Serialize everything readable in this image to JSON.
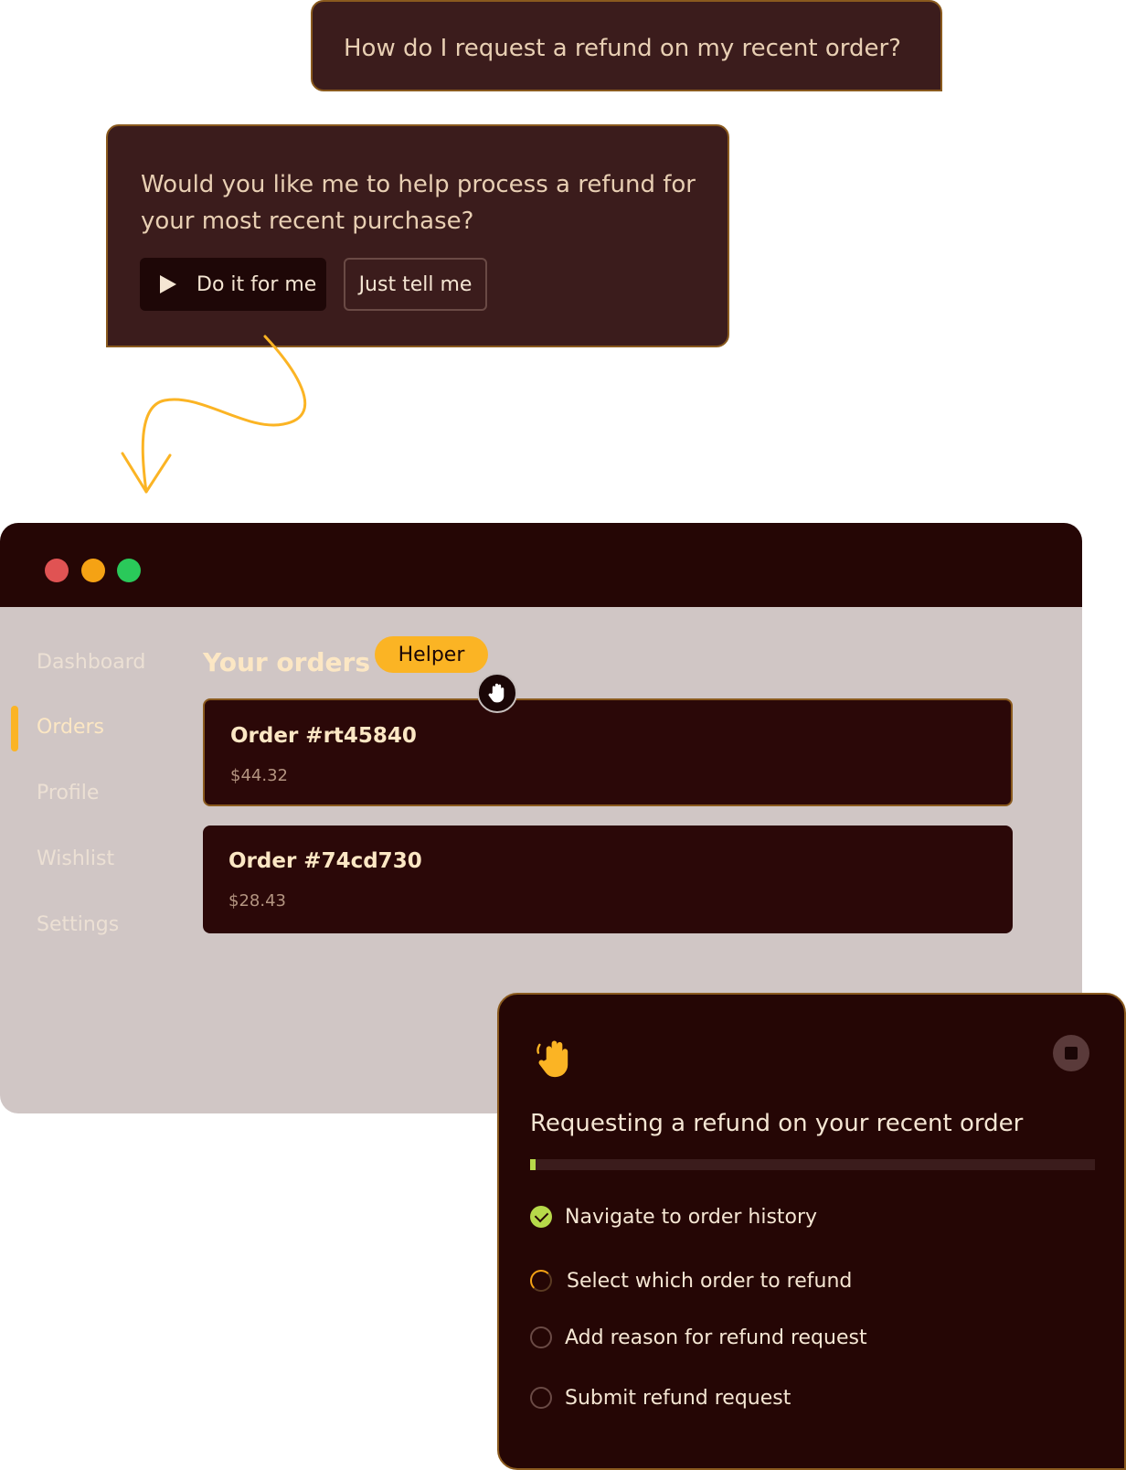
{
  "chat": {
    "user_message": "How do I request a refund on my recent order?",
    "assistant_message": "Would you like me to help process a refund for your most recent purchase?",
    "do_it_label": "Do it for me",
    "just_tell_label": "Just tell me"
  },
  "window": {
    "traffic_lights": [
      "close",
      "minimize",
      "zoom"
    ],
    "colors": {
      "red": "#e05353",
      "yellow": "#f5a214",
      "green": "#2ac95a"
    }
  },
  "sidebar": {
    "items": [
      {
        "label": "Dashboard",
        "active": false
      },
      {
        "label": "Orders",
        "active": true
      },
      {
        "label": "Profile",
        "active": false
      },
      {
        "label": "Wishlist",
        "active": false
      },
      {
        "label": "Settings",
        "active": false
      }
    ]
  },
  "main": {
    "title": "Your orders",
    "helper_label": "Helper",
    "orders": [
      {
        "name": "Order #rt45840",
        "price": "$44.32"
      },
      {
        "name": "Order #74cd730",
        "price": "$28.43"
      }
    ]
  },
  "helper_panel": {
    "title": "Requesting a refund on your recent order",
    "progress_fraction": 0.01,
    "steps": [
      {
        "label": "Navigate to order history",
        "status": "done"
      },
      {
        "label": "Select which order to refund",
        "status": "in-progress"
      },
      {
        "label": "Add reason for refund request",
        "status": "pending"
      },
      {
        "label": "Submit refund request",
        "status": "pending"
      }
    ],
    "icons": {
      "logo": "waving-hand-icon",
      "stop": "stop-icon"
    }
  },
  "colors": {
    "accent": "#fbb424",
    "dark": "#250605",
    "success": "#b7d94a"
  }
}
